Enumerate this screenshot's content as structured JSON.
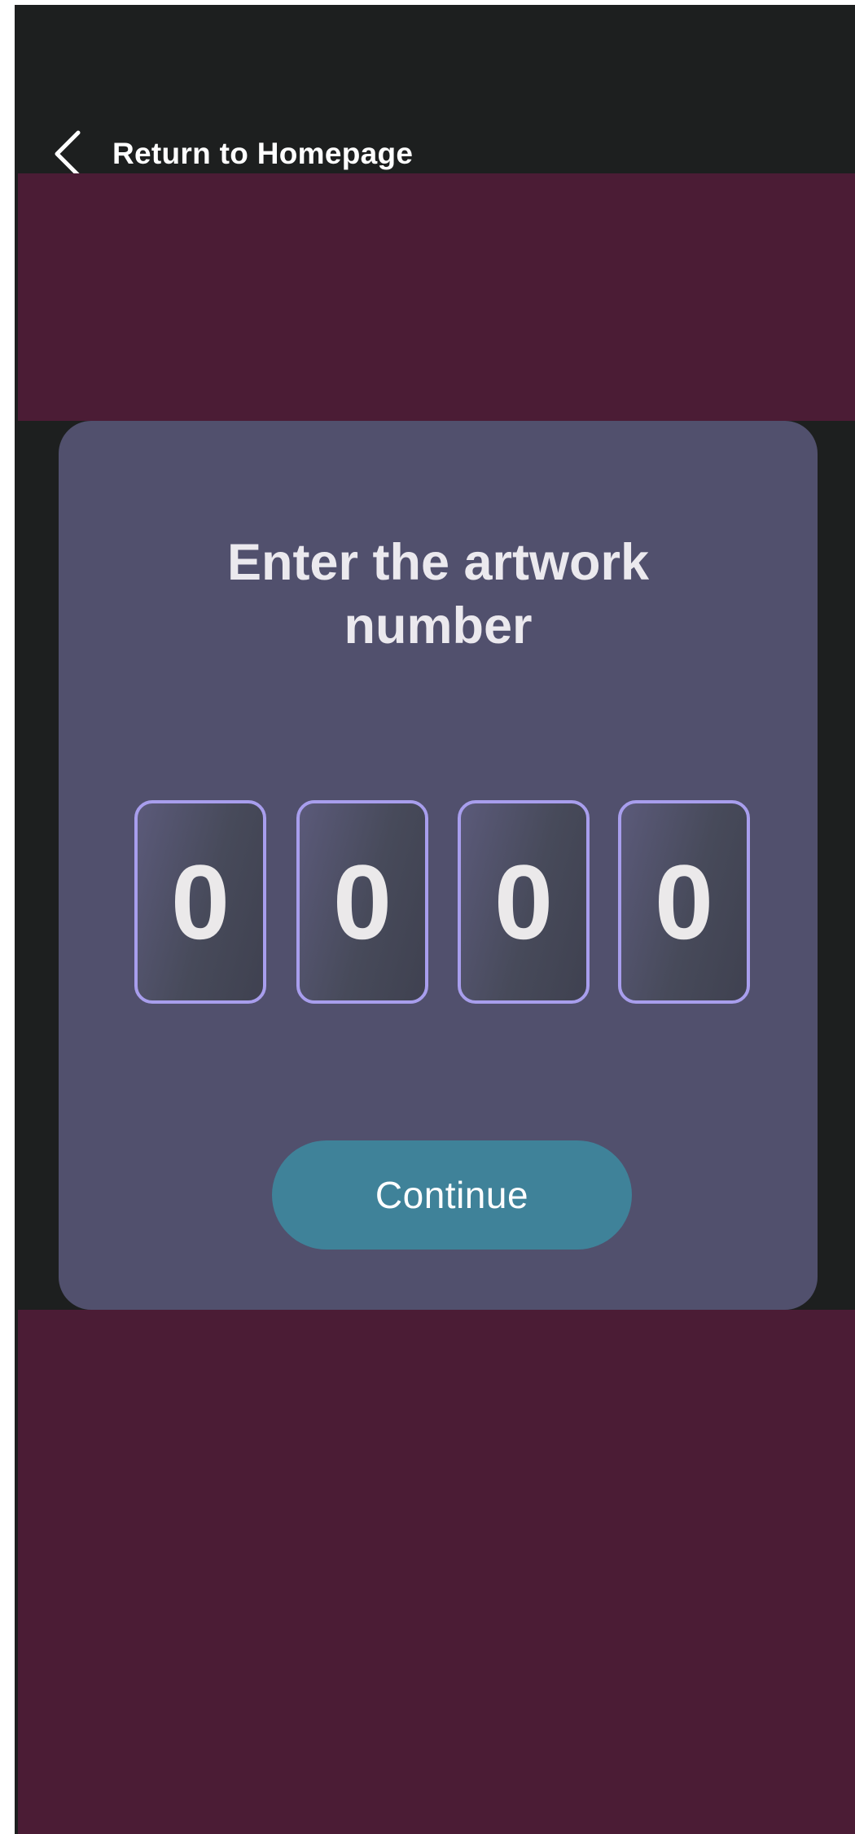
{
  "nav": {
    "back_label": "Return to Homepage",
    "back_icon": "chevron-left-icon"
  },
  "card": {
    "title_line1": "Enter the artwork",
    "title_line2": "number",
    "digits": [
      "0",
      "0",
      "0",
      "0"
    ],
    "continue_label": "Continue"
  },
  "colors": {
    "background": "#1d1f1f",
    "band": "#4b1c35",
    "card": "#51506d",
    "digit_border": "#a89eed",
    "button": "#3f8299",
    "text": "#ebe9ee"
  }
}
